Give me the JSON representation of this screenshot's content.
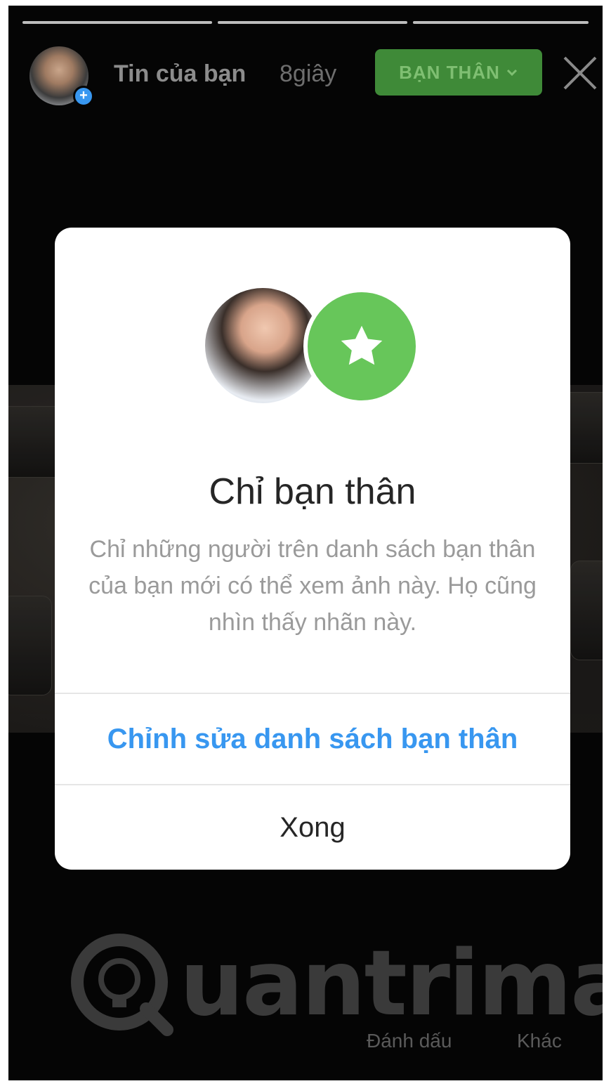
{
  "header": {
    "title": "Tin của bạn",
    "time": "8giây",
    "audience_button": "BẠN THÂN",
    "icons": [
      "avatar",
      "add-icon",
      "chevron-down-icon",
      "close-icon"
    ]
  },
  "modal": {
    "title": "Chỉ bạn thân",
    "description": "Chỉ những người trên danh sách bạn thân của bạn mới có thể xem ảnh này. Họ cũng nhìn thấy nhãn này.",
    "edit_button": "Chỉnh sửa danh sách bạn thân",
    "done_button": "Xong",
    "icons": [
      "avatar",
      "star-icon"
    ]
  },
  "bottom": {
    "mark_label": "Đánh dấu",
    "more_label": "Khác"
  },
  "watermark": {
    "text": "uantrimang"
  },
  "colors": {
    "accent_blue": "#3897f0",
    "close_friends_green": "#67c65a",
    "button_green": "#3f8a38"
  }
}
